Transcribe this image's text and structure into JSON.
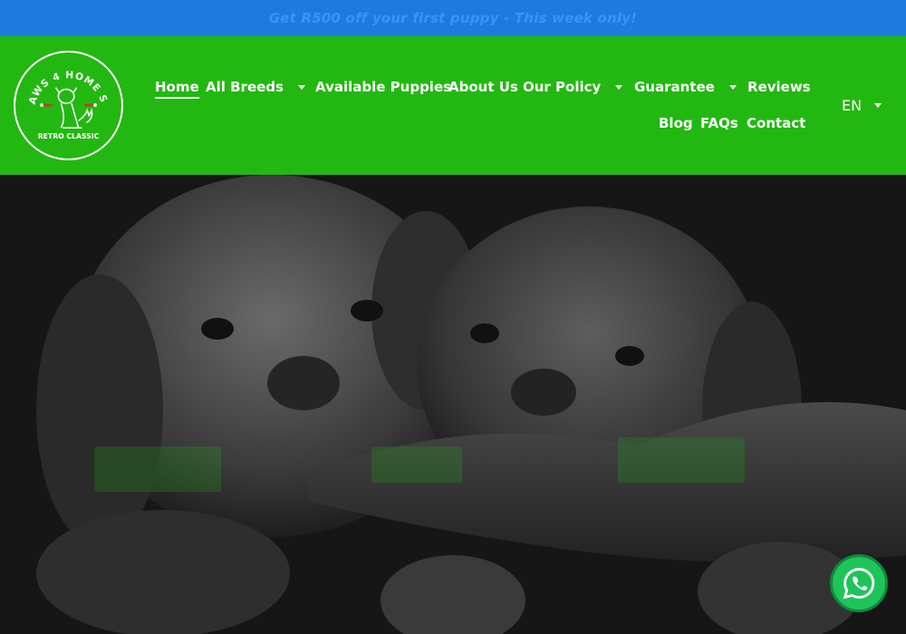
{
  "promo": {
    "text": "Get R500 off your first puppy - This week only!"
  },
  "logo": {
    "top_text": "PAWS 4 HOME SA",
    "bottom_text": "RETRO CLASSIC"
  },
  "nav": {
    "home": "Home",
    "all_breeds": "All Breeds",
    "available_puppies": "Available Puppies",
    "about_us": "About Us",
    "our_policy": "Our Policy",
    "guarantee": "Guarantee",
    "reviews": "Reviews",
    "blog": "Blog",
    "faqs": "FAQs",
    "contact": "Contact",
    "language": "EN"
  },
  "colors": {
    "promo_bg": "#1f7ae0",
    "header_bg": "#22b811",
    "whatsapp": "#1ec45a"
  }
}
